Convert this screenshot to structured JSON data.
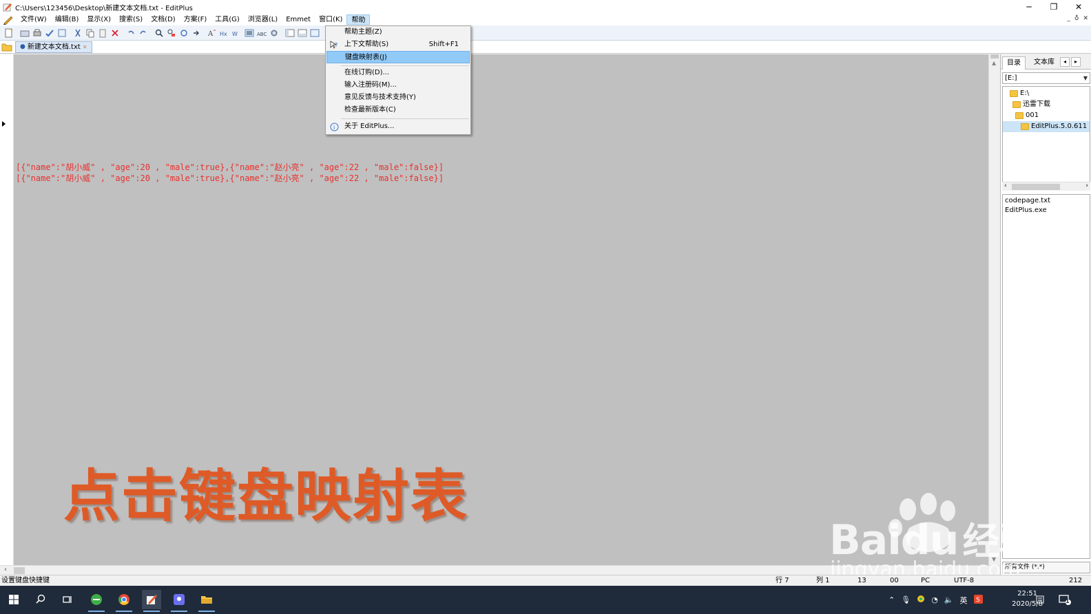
{
  "window": {
    "title": "C:\\Users\\123456\\Desktop\\新建文本文档.txt - EditPlus",
    "minimize": "─",
    "restore": "❐",
    "close": "✕"
  },
  "menubar": {
    "items": [
      "文件(W)",
      "编辑(B)",
      "显示(X)",
      "搜索(S)",
      "文档(D)",
      "方案(F)",
      "工具(G)",
      "浏览器(L)",
      "Emmet",
      "窗口(K)",
      "帮助"
    ],
    "mdi": [
      "_",
      "♁",
      "✕"
    ]
  },
  "tab": {
    "label": "新建文本文档.txt",
    "dot": "●",
    "close": "✕"
  },
  "help_menu": {
    "items": [
      {
        "label": "帮助主题(Z)",
        "shortcut": ""
      },
      {
        "label": "上下文帮助(S)",
        "shortcut": "Shift+F1"
      },
      {
        "label": "键盘映射表(J)",
        "shortcut": ""
      },
      {
        "label": "在线订购(D)...",
        "shortcut": ""
      },
      {
        "label": "输入注册码(M)...",
        "shortcut": ""
      },
      {
        "label": "意见反馈与技术支持(Y)",
        "shortcut": ""
      },
      {
        "label": "检查最新版本(C)",
        "shortcut": ""
      },
      {
        "label": "关于 EditPlus...",
        "shortcut": ""
      }
    ],
    "highlighted_index": 2
  },
  "editor": {
    "lines": [
      "[{\"name\":\"胡小威\" , \"age\":20 , \"male\":true},{\"name\":\"赵小亮\" , \"age\":22 , \"male\":false}]",
      "[{\"name\":\"胡小威\" , \"age\":20 , \"male\":true},{\"name\":\"赵小亮\" , \"age\":22 , \"male\":false}]"
    ],
    "text_color": "#e8312f",
    "background": "#c0c0c0"
  },
  "caption": "点击键盘映射表",
  "right_panel": {
    "tabs": [
      "目录",
      "文本库"
    ],
    "nav_prev": "◂",
    "nav_next": "▸",
    "drive": "[E:]",
    "tree": [
      "E:\\",
      "迅雷下载",
      "001",
      "EditPlus.5.0.611"
    ],
    "files": [
      "codepage.txt",
      "EditPlus.exe"
    ],
    "filter": "所有文件 (*.*)"
  },
  "watermark": {
    "brand": "Bai",
    "brand2": "du",
    "cn": "经验",
    "url": "jingyan.baidu.com"
  },
  "statusbar": {
    "message": "设置键盘快捷键",
    "row": "行 7",
    "col": "列 1",
    "n13": "13",
    "n00": "00",
    "pc": "PC",
    "enc": "UTF-8",
    "size": "212"
  },
  "taskbar": {
    "time": "22:51",
    "date": "2020/5/8",
    "ime": "英",
    "notif_count": "1"
  }
}
